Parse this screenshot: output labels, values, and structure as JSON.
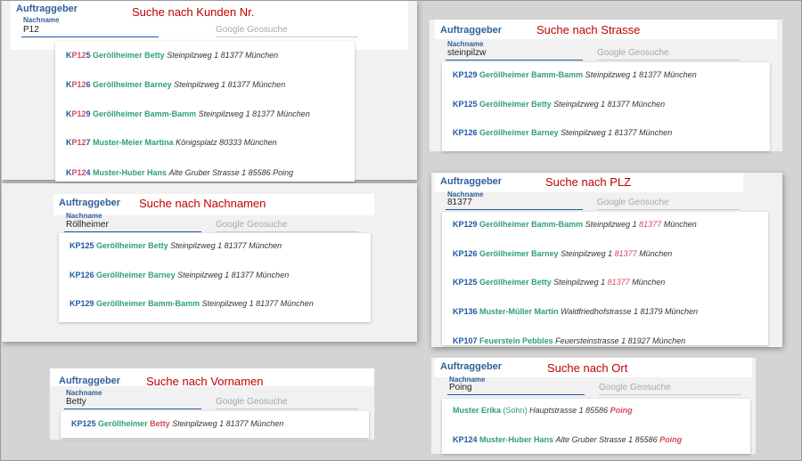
{
  "common": {
    "title": "Auftraggeber",
    "field_label": "Nachname",
    "geo_placeholder": "Google Geosuche"
  },
  "panels": {
    "kunden": {
      "caption": "Suche nach Kunden Nr.",
      "input": "P12",
      "items": [
        {
          "k1": "K",
          "hl": "P12",
          "k2": "5",
          "name": "Geröllheimer Betty",
          "addr": "Steinpilzweg 1 81377 München"
        },
        {
          "k1": "K",
          "hl": "P12",
          "k2": "6",
          "name": "Geröllheimer Barney",
          "addr": "Steinpilzweg 1 81377 München"
        },
        {
          "k1": "K",
          "hl": "P12",
          "k2": "9",
          "name": "Geröllheimer Bamm-Bamm",
          "addr": "Steinpilzweg 1 81377 München"
        },
        {
          "k1": "K",
          "hl": "P12",
          "k2": "7",
          "name": "Muster-Meier Martina",
          "addr": "Königsplatz 80333 München"
        },
        {
          "k1": "K",
          "hl": "P12",
          "k2": "4",
          "name": "Muster-Huber Hans",
          "addr": "Alte Gruber Strasse 1 85586 Poing"
        }
      ]
    },
    "strasse": {
      "caption": "Suche nach Strasse",
      "input": "steinpilzw",
      "items": [
        {
          "k": "KP129",
          "name": "Geröllheimer Bamm-Bamm",
          "addr": "Steinpilzweg 1 81377 München"
        },
        {
          "k": "KP125",
          "name": "Geröllheimer Betty",
          "addr": "Steinpilzweg 1 81377 München"
        },
        {
          "k": "KP126",
          "name": "Geröllheimer Barney",
          "addr": "Steinpilzweg 1 81377 München"
        }
      ]
    },
    "nachname": {
      "caption": "Suche nach Nachnamen",
      "input": "Röllheimer",
      "items": [
        {
          "k": "KP125",
          "name": "Geröllheimer Betty",
          "addr": "Steinpilzweg 1 81377 München"
        },
        {
          "k": "KP126",
          "name": "Geröllheimer Barney",
          "addr": "Steinpilzweg 1 81377 München"
        },
        {
          "k": "KP129",
          "name": "Geröllheimer Bamm-Bamm",
          "addr": "Steinpilzweg 1 81377 München"
        }
      ]
    },
    "plz": {
      "caption": "Suche nach PLZ",
      "input": "81377",
      "items": [
        {
          "k": "KP129",
          "name": "Geröllheimer Bamm-Bamm",
          "addr": "Steinpilzweg 1",
          "zip": "81377",
          "city": "München"
        },
        {
          "k": "KP126",
          "name": "Geröllheimer Barney",
          "addr": "Steinpilzweg 1",
          "zip": "81377",
          "city": "München"
        },
        {
          "k": "KP125",
          "name": "Geröllheimer Betty",
          "addr": "Steinpilzweg 1",
          "zip": "81377",
          "city": "München"
        },
        {
          "k": "KP136",
          "name": "Muster-Müller Martin",
          "addr": "Waldfriedhofstrasse 1 81379 München"
        },
        {
          "k": "KP107",
          "name": "Feuerstein Pebbles",
          "addr": "Feuersteinstrasse 1 81927 München"
        }
      ]
    },
    "vorname": {
      "caption": "Suche nach Vornamen",
      "input": "Betty",
      "items": [
        {
          "k": "KP125",
          "name": "Geröllheimer",
          "hl": "Betty",
          "addr": "Steinpilzweg 1 81377 München"
        }
      ]
    },
    "ort": {
      "caption": "Suche nach Ort",
      "input": "Poing",
      "items": [
        {
          "k": "",
          "name": "Muster Erika",
          "sub": "(Sohn)",
          "addr": "Hauptstrasse 1 85586",
          "city": "Poing"
        },
        {
          "k": "KP124",
          "name": "Muster-Huber Hans",
          "addr": "Alte Gruber Strasse 1 85586",
          "city": "Poing"
        }
      ]
    }
  }
}
